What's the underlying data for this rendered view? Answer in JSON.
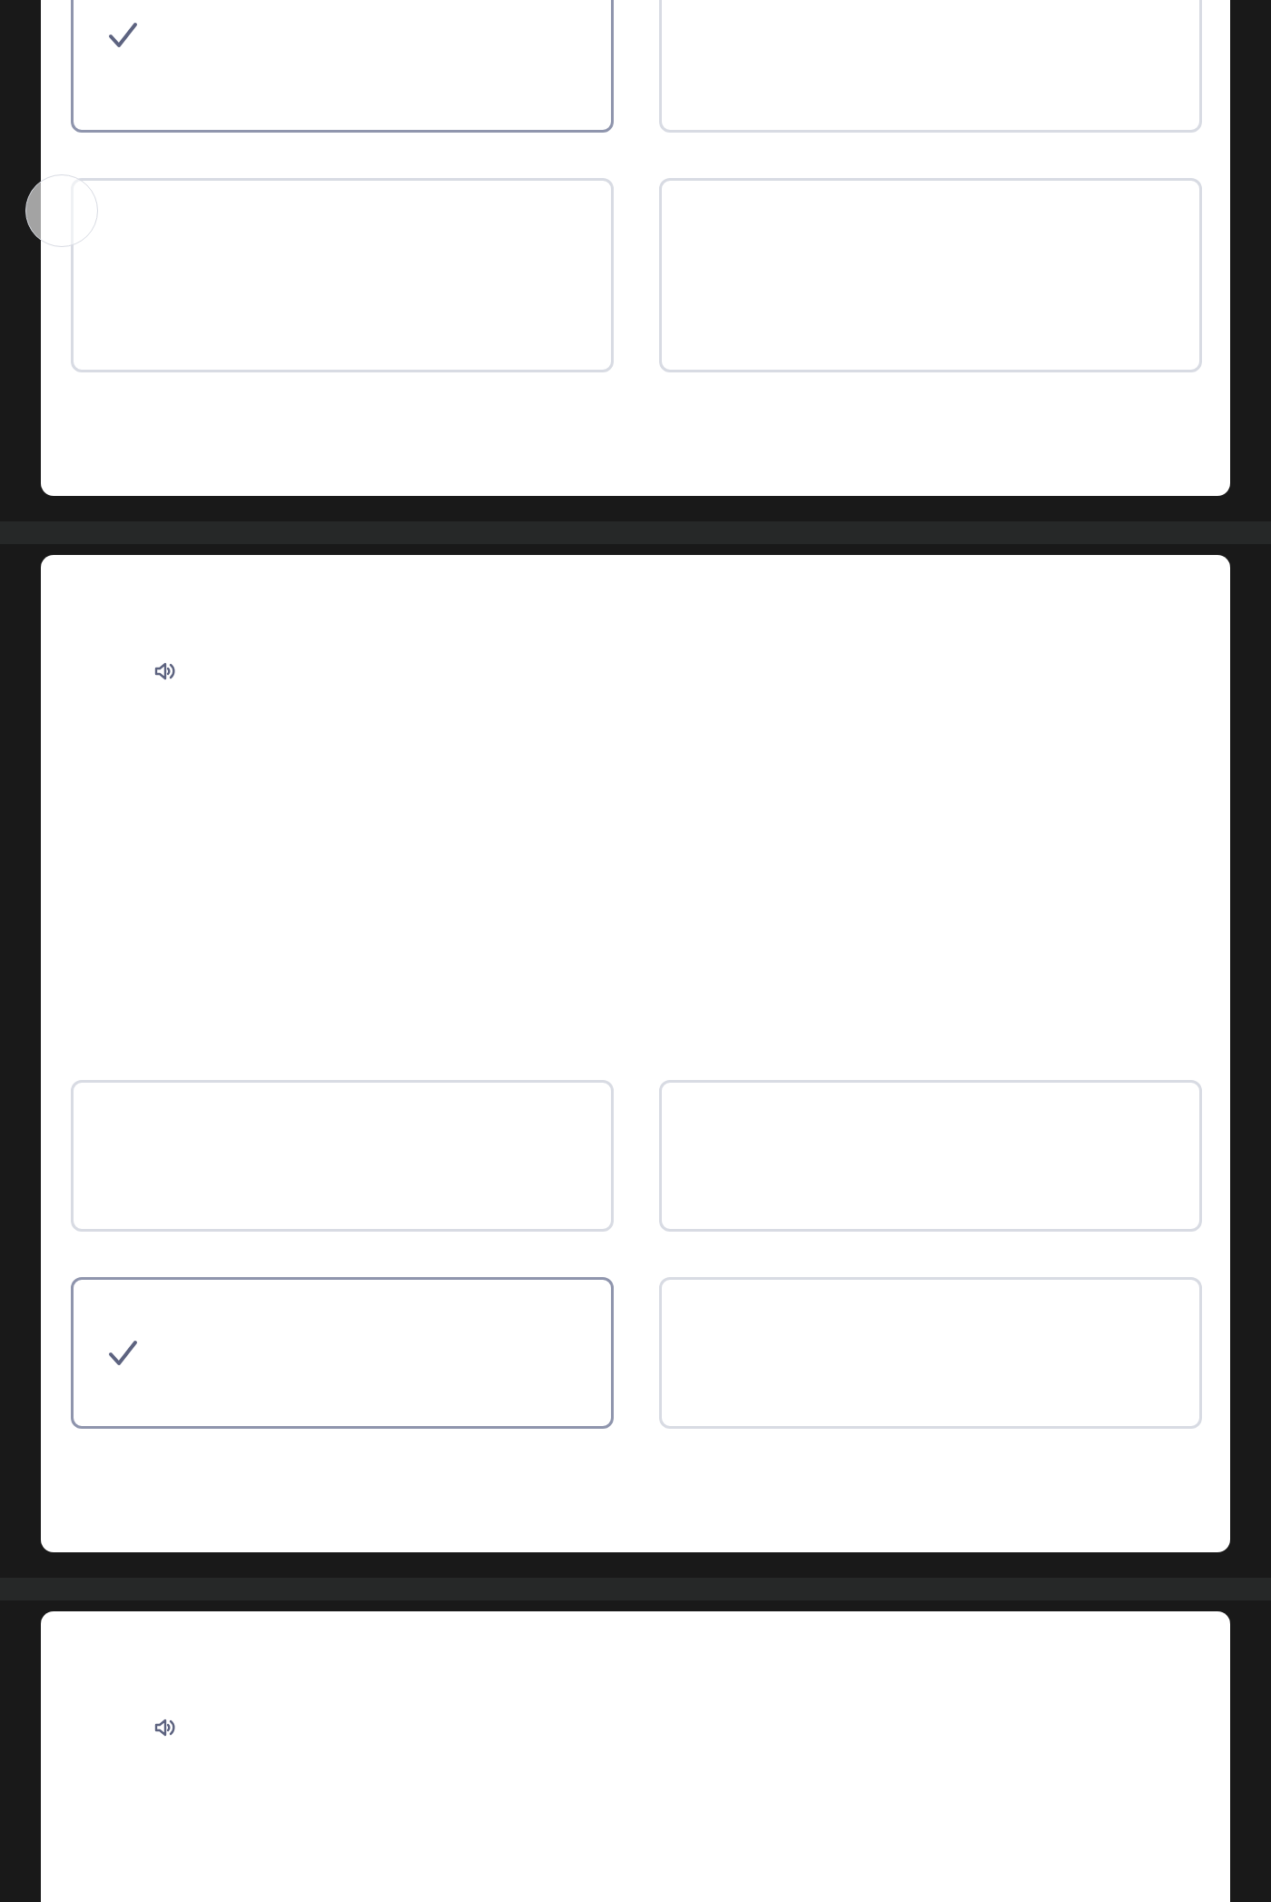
{
  "questions": [
    {
      "audio_button": false,
      "options": [
        {
          "selected": true
        },
        {
          "selected": false
        },
        {
          "selected": false
        },
        {
          "selected": false
        }
      ]
    },
    {
      "audio_button": true,
      "options": [
        {
          "selected": false
        },
        {
          "selected": false
        },
        {
          "selected": true
        },
        {
          "selected": false
        }
      ]
    },
    {
      "audio_button": true
    }
  ]
}
